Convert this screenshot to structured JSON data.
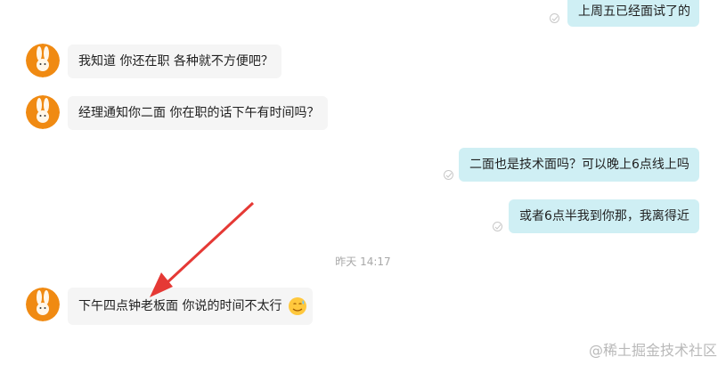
{
  "messages": [
    {
      "side": "right",
      "text": "上周五已经面试了的"
    },
    {
      "side": "left",
      "text": "我知道 你还在职 各种就不方便吧？"
    },
    {
      "side": "left",
      "text": "经理通知你二面 你在职的话下午有时间吗？"
    },
    {
      "side": "right",
      "text": "二面也是技术面吗？可以晚上6点线上吗"
    },
    {
      "side": "right",
      "text": "或者6点半我到你那，我离得近"
    },
    {
      "side": "left",
      "text": "下午四点钟老板面 你说的时间不太行"
    }
  ],
  "timestamp": "昨天 14:17",
  "watermark": "@稀土掘金技术社区",
  "emoji_name": "sweat-smile-emoji",
  "icons": {
    "avatar": "rabbit-avatar-icon",
    "read_receipt": "read-check-icon",
    "annotation": "red-arrow"
  },
  "colors": {
    "left_bubble": "#f5f5f5",
    "right_bubble": "#cfeff4",
    "avatar_bg": "#f08a12",
    "arrow": "#e53935"
  }
}
